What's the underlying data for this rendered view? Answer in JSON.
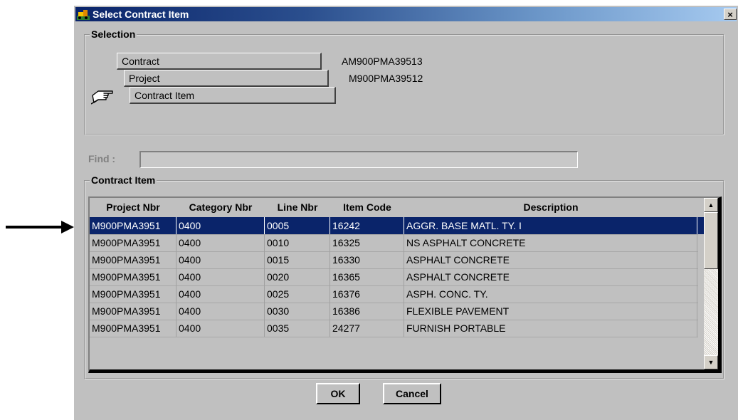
{
  "window": {
    "title": "Select Contract Item",
    "close_label": "×"
  },
  "selection": {
    "group_title": "Selection",
    "rows": [
      {
        "label": "Contract",
        "value": "AM900PMA39513"
      },
      {
        "label": "Project",
        "value": "M900PMA39512"
      },
      {
        "label": "Contract Item",
        "value": ""
      }
    ]
  },
  "find": {
    "label": "Find :",
    "value": ""
  },
  "contract_item": {
    "group_title": "Contract Item",
    "columns": [
      "Project Nbr",
      "Category Nbr",
      "Line Nbr",
      "Item Code",
      "Description"
    ],
    "rows": [
      [
        "M900PMA3951",
        "0400",
        "0005",
        "16242",
        "AGGR. BASE MATL. TY. I"
      ],
      [
        "M900PMA3951",
        "0400",
        "0010",
        "16325",
        "NS ASPHALT CONCRETE"
      ],
      [
        "M900PMA3951",
        "0400",
        "0015",
        "16330",
        "ASPHALT CONCRETE"
      ],
      [
        "M900PMA3951",
        "0400",
        "0020",
        "16365",
        "ASPHALT CONCRETE"
      ],
      [
        "M900PMA3951",
        "0400",
        "0025",
        "16376",
        "ASPH. CONC. TY."
      ],
      [
        "M900PMA3951",
        "0400",
        "0030",
        "16386",
        "FLEXIBLE PAVEMENT"
      ],
      [
        "M900PMA3951",
        "0400",
        "0035",
        "24277",
        "FURNISH PORTABLE"
      ]
    ],
    "selected_row": 0
  },
  "buttons": {
    "ok": "OK",
    "cancel": "Cancel"
  },
  "colors": {
    "selection": "#0a246a",
    "face": "#c0c0c0"
  }
}
